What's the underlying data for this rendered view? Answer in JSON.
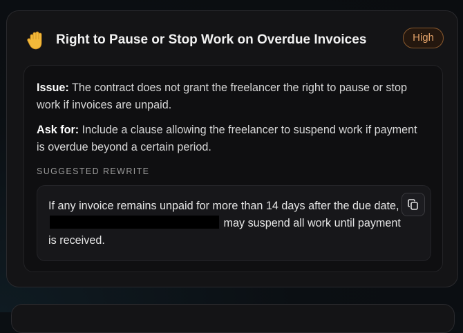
{
  "card": {
    "icon": "raised-hand-icon",
    "title": "Right to Pause or Stop Work on Overdue Invoices",
    "severity": "High",
    "colors": {
      "card_bg": "#141416",
      "badge_text": "#e6a46a",
      "badge_border": "#8a5a2e"
    }
  },
  "issue": {
    "label": "Issue:",
    "text": " The contract does not grant the freelancer the right to pause or stop work if invoices are unpaid."
  },
  "ask": {
    "label": "Ask for:",
    "text": " Include a clause allowing the freelancer to suspend work if payment is overdue beyond a certain period."
  },
  "suggested": {
    "label": "SUGGESTED REWRITE",
    "text_before": "If any invoice remains unpaid for more than 14 days after the due date,",
    "text_after": "may suspend all work until payment is received.",
    "copy_icon": "copy-icon"
  }
}
